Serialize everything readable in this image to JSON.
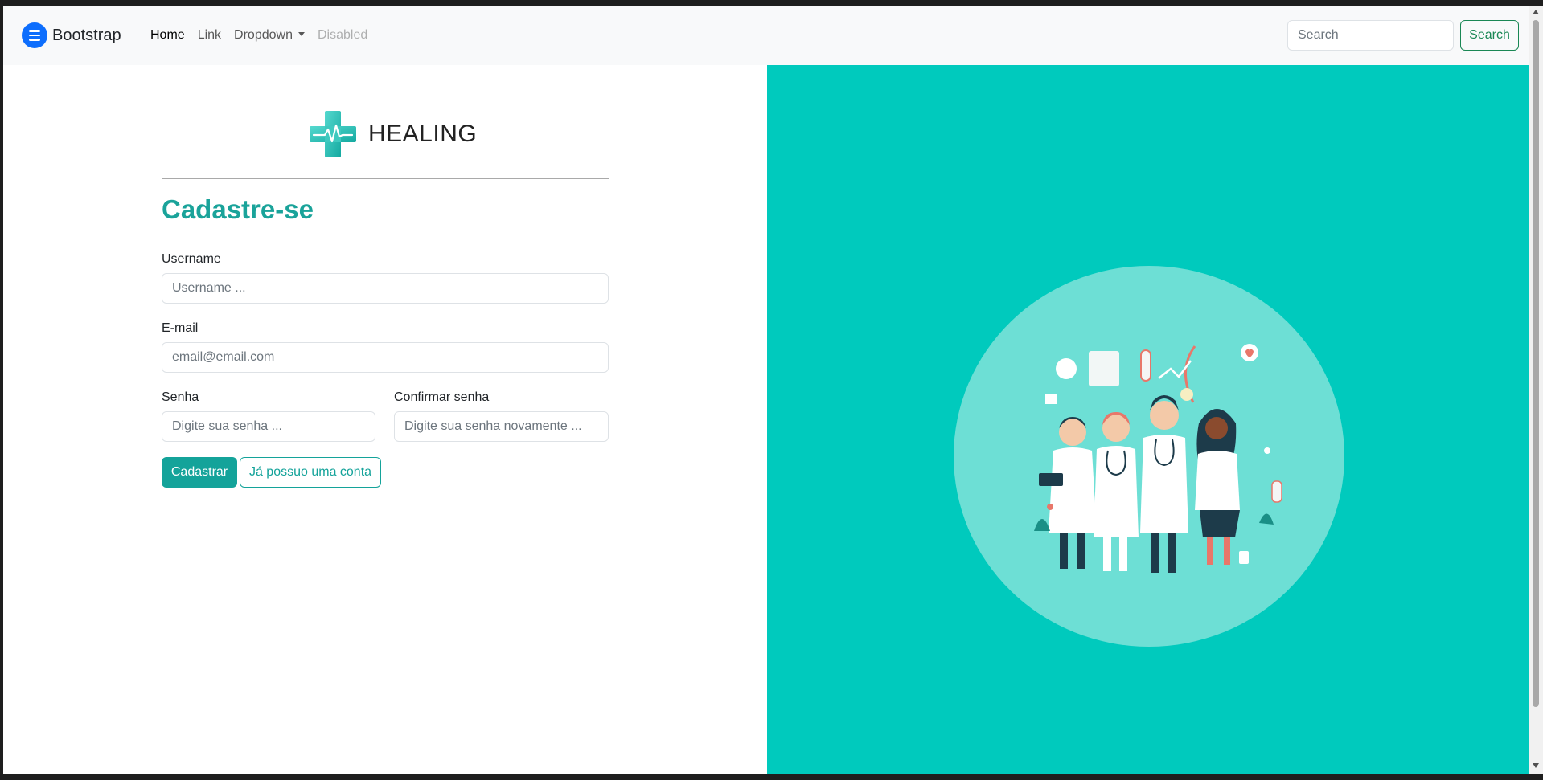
{
  "navbar": {
    "brand": "Bootstrap",
    "links": [
      "Home",
      "Link",
      "Dropdown",
      "Disabled"
    ],
    "search_placeholder": "Search",
    "search_button": "Search"
  },
  "brand_logo": "HEALING",
  "form": {
    "title": "Cadastre-se",
    "username_label": "Username",
    "username_placeholder": "Username ...",
    "email_label": "E-mail",
    "email_placeholder": "email@email.com",
    "password_label": "Senha",
    "password_placeholder": "Digite sua senha ...",
    "confirm_label": "Confirmar senha",
    "confirm_placeholder": "Digite sua senha novamente ...",
    "submit_button": "Cadastrar",
    "login_button": "Já possuo uma conta"
  },
  "colors": {
    "accent": "#14a39a",
    "panel": "#00cabd",
    "circle": "#6ddfd5"
  },
  "illustration": "doctors-group-illustration"
}
